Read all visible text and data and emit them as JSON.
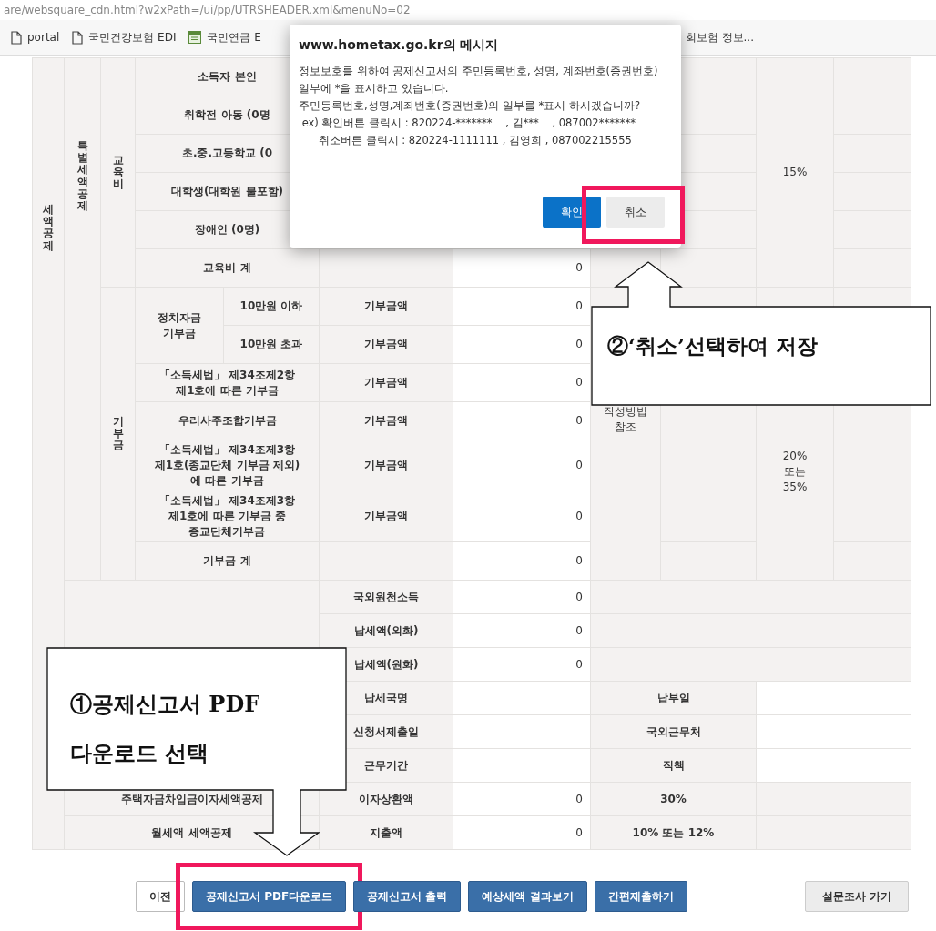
{
  "browser": {
    "address": "are/websquare_cdn.html?w2xPath=/ui/pp/UTRSHEADER.xml&menuNo=02",
    "bookmarks": [
      {
        "label": "portal"
      },
      {
        "label": "국민건강보험 EDI"
      },
      {
        "label": "국민연금 E"
      },
      {
        "label": "회보험 정보..."
      }
    ]
  },
  "table": {
    "section_label": "세액공제",
    "group_label": "특별세액공제",
    "groups": [
      {
        "label": "교육비",
        "rate": "15%",
        "rows": [
          {
            "item": "소득자 본인"
          },
          {
            "item": "취학전 아동 (0명"
          },
          {
            "item": "초.중.고등학교 (0"
          },
          {
            "item": "대학생(대학원 불포함)"
          },
          {
            "item": "장애인 (0명)"
          },
          {
            "item": "교육비 계",
            "amount": "0"
          }
        ]
      },
      {
        "label": "기부금",
        "note": "작성방법\n참조",
        "rate": "20%\n또는\n35%",
        "rows": [
          {
            "item": "정치자금\n기부금",
            "children": [
              {
                "item": "10만원 이하",
                "field": "기부금액",
                "amount": "0"
              },
              {
                "item": "10만원 초과",
                "field": "기부금액",
                "amount": "0"
              }
            ]
          },
          {
            "item": "「소득세법」 제34조제2항\n제1호에 따른 기부금",
            "field": "기부금액",
            "amount": "0"
          },
          {
            "item": "우리사주조합기부금",
            "field": "기부금액",
            "amount": "0"
          },
          {
            "item": "「소득세법」 제34조제3항\n제1호(종교단체 기부금 제외)\n에 따른 기부금",
            "field": "기부금액",
            "amount": "0"
          },
          {
            "item": "「소득세법」 제34조제3항\n제1호에 따른 기부금 중\n종교단체기부금",
            "field": "기부금액",
            "amount": "0"
          },
          {
            "item": "기부금 계",
            "amount": "0"
          }
        ]
      }
    ],
    "other_rows": [
      {
        "field": "국외원천소득",
        "amount": "0"
      },
      {
        "field": "납세액(외화)",
        "amount": "0"
      },
      {
        "field": "납세액(원화)",
        "amount": "0"
      },
      {
        "field": "납세국명",
        "right_label": "납부일"
      },
      {
        "field": "신청서제출일",
        "right_label": "국외근무처"
      },
      {
        "field": "근무기간",
        "right_label": "직책"
      },
      {
        "label": "주택자금차입금이자세액공제",
        "field": "이자상환액",
        "amount": "0",
        "rate": "30%"
      },
      {
        "label": "월세액 세액공제",
        "field": "지출액",
        "amount": "0",
        "rate": "10% 또는 12%"
      }
    ]
  },
  "bottom_buttons": [
    {
      "label": "이전",
      "kind": "plain",
      "highlighted": false
    },
    {
      "label": "공제신고서 PDF다운로드",
      "kind": "primary",
      "highlighted": true
    },
    {
      "label": "공제신고서 출력",
      "kind": "primary",
      "highlighted": false
    },
    {
      "label": "예상세액 결과보기",
      "kind": "primary",
      "highlighted": false
    },
    {
      "label": "간편제출하기",
      "kind": "primary",
      "highlighted": false
    },
    {
      "label": "설문조사 가기",
      "kind": "survey",
      "highlighted": false
    }
  ],
  "dialog": {
    "title": "www.hometax.go.kr의 메시지",
    "message": "정보보호를 위하여 공제신고서의 주민등록번호, 성명, 계좌번호(증권번호) 일부에 *을 표시하고 있습니다.\n주민등록번호,성명,계좌번호(증권번호)의 일부를 *표시 하시겠습니까?\n ex) 확인버튼 클릭시 : 820224-*******    , 김***    , 087002*******\n      취소버튼 클릭시 : 820224-1111111 , 김영희 , 087002215555",
    "buttons": [
      {
        "label": "확인",
        "kind": "primary",
        "highlighted": false
      },
      {
        "label": "취소",
        "kind": "plain",
        "highlighted": true
      }
    ]
  },
  "annotations": [
    {
      "text": "②‘취소’선택하여 저장"
    },
    {
      "text": "①공제신고서 PDF\n다운로드 선택"
    }
  ]
}
